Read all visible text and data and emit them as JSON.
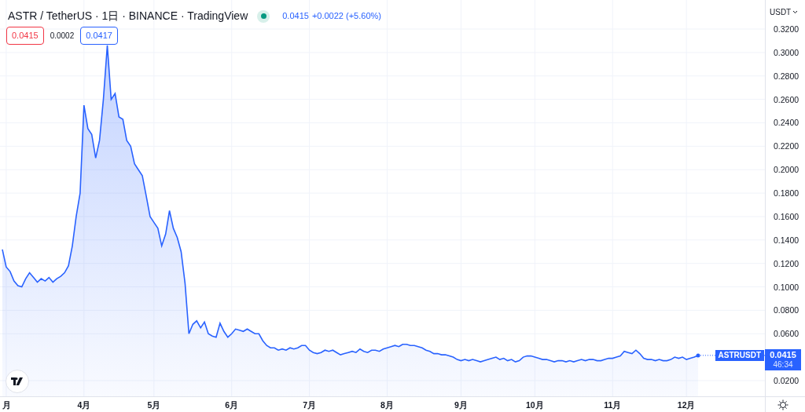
{
  "header": {
    "symbol": "ASTR / TetherUS · 1日 · BINANCE · TradingView",
    "market_open": true,
    "last": "0.0415",
    "change": "+0.0022 (+5.60%)"
  },
  "quote": {
    "bid": "0.0415",
    "spread": "0.0002",
    "ask": "0.0417"
  },
  "currency": "USDT",
  "last_price": {
    "price": "0.0415",
    "countdown": "46:34"
  },
  "chart_data": {
    "type": "area",
    "grid": true,
    "ylim": [
      0.0066,
      0.3448
    ],
    "categories": [
      null,
      "月",
      null,
      null,
      null,
      null,
      null,
      null,
      null,
      null,
      null,
      null,
      null,
      null,
      null,
      null,
      null,
      null,
      null,
      null,
      null,
      "4月",
      null,
      null,
      null,
      null,
      null,
      null,
      null,
      null,
      null,
      null,
      null,
      null,
      null,
      null,
      null,
      null,
      null,
      "5月",
      null,
      null,
      null,
      null,
      null,
      null,
      null,
      null,
      null,
      null,
      null,
      null,
      null,
      null,
      null,
      null,
      null,
      null,
      null,
      "6月",
      null,
      null,
      null,
      null,
      null,
      null,
      null,
      null,
      null,
      null,
      null,
      null,
      null,
      null,
      null,
      null,
      null,
      null,
      null,
      "7月",
      null,
      null,
      null,
      null,
      null,
      null,
      null,
      null,
      null,
      null,
      null,
      null,
      null,
      null,
      null,
      null,
      null,
      null,
      null,
      "8月",
      null,
      null,
      null,
      null,
      null,
      null,
      null,
      null,
      null,
      null,
      null,
      null,
      null,
      null,
      null,
      null,
      null,
      null,
      "9月",
      null,
      null,
      null,
      null,
      null,
      null,
      null,
      null,
      null,
      null,
      null,
      null,
      null,
      null,
      null,
      null,
      null,
      null,
      "10月",
      null,
      null,
      null,
      null,
      null,
      null,
      null,
      null,
      null,
      null,
      null,
      null,
      null,
      null,
      null,
      null,
      null,
      null,
      null,
      "11月",
      null,
      null,
      null,
      null,
      null,
      null,
      null,
      null,
      null,
      null,
      null,
      null,
      null,
      null,
      null,
      null,
      null,
      null,
      "12月",
      null,
      null,
      null
    ],
    "yticks": [
      {
        "value": 0.02,
        "label": "0.0200"
      },
      {
        "value": 0.06,
        "label": "0.0600"
      },
      {
        "value": 0.08,
        "label": "0.0800"
      },
      {
        "value": 0.1,
        "label": "0.1000"
      },
      {
        "value": 0.12,
        "label": "0.1200"
      },
      {
        "value": 0.14,
        "label": "0.1400"
      },
      {
        "value": 0.16,
        "label": "0.1600"
      },
      {
        "value": 0.18,
        "label": "0.1800"
      },
      {
        "value": 0.2,
        "label": "0.2000"
      },
      {
        "value": 0.22,
        "label": "0.2200"
      },
      {
        "value": 0.24,
        "label": "0.2400"
      },
      {
        "value": 0.26,
        "label": "0.2600"
      },
      {
        "value": 0.28,
        "label": "0.2800"
      },
      {
        "value": 0.3,
        "label": "0.3000"
      },
      {
        "value": 0.32,
        "label": "0.3200"
      }
    ],
    "series": [
      {
        "name": "ASTRUSDT",
        "color": "#2962ff",
        "values": [
          0.132,
          0.117,
          0.113,
          0.105,
          0.101,
          0.1,
          0.107,
          0.112,
          0.108,
          0.104,
          0.107,
          0.105,
          0.108,
          0.104,
          0.107,
          0.109,
          0.112,
          0.118,
          0.135,
          0.16,
          0.18,
          0.255,
          0.235,
          0.23,
          0.21,
          0.225,
          0.26,
          0.306,
          0.26,
          0.265,
          0.245,
          0.243,
          0.225,
          0.22,
          0.205,
          0.2,
          0.195,
          0.178,
          0.16,
          0.155,
          0.15,
          0.135,
          0.145,
          0.165,
          0.15,
          0.142,
          0.13,
          0.103,
          0.06,
          0.068,
          0.071,
          0.065,
          0.07,
          0.06,
          0.058,
          0.057,
          0.069,
          0.062,
          0.057,
          0.06,
          0.064,
          0.063,
          0.062,
          0.064,
          0.062,
          0.06,
          0.06,
          0.054,
          0.05,
          0.048,
          0.048,
          0.046,
          0.047,
          0.046,
          0.048,
          0.047,
          0.048,
          0.05,
          0.05,
          0.046,
          0.044,
          0.043,
          0.044,
          0.046,
          0.045,
          0.046,
          0.044,
          0.042,
          0.043,
          0.044,
          0.045,
          0.044,
          0.047,
          0.045,
          0.044,
          0.046,
          0.046,
          0.045,
          0.047,
          0.048,
          0.049,
          0.05,
          0.049,
          0.051,
          0.051,
          0.05,
          0.05,
          0.049,
          0.048,
          0.046,
          0.045,
          0.043,
          0.043,
          0.042,
          0.042,
          0.041,
          0.04,
          0.038,
          0.037,
          0.038,
          0.037,
          0.038,
          0.037,
          0.036,
          0.037,
          0.038,
          0.039,
          0.04,
          0.038,
          0.039,
          0.037,
          0.038,
          0.036,
          0.037,
          0.04,
          0.041,
          0.041,
          0.04,
          0.039,
          0.038,
          0.038,
          0.037,
          0.036,
          0.037,
          0.037,
          0.036,
          0.037,
          0.036,
          0.037,
          0.038,
          0.037,
          0.038,
          0.038,
          0.037,
          0.037,
          0.038,
          0.039,
          0.039,
          0.04,
          0.041,
          0.045,
          0.044,
          0.043,
          0.046,
          0.043,
          0.039,
          0.038,
          0.038,
          0.037,
          0.038,
          0.037,
          0.037,
          0.038,
          0.04,
          0.039,
          0.04,
          0.038,
          0.039,
          0.04,
          0.0415
        ]
      }
    ]
  }
}
